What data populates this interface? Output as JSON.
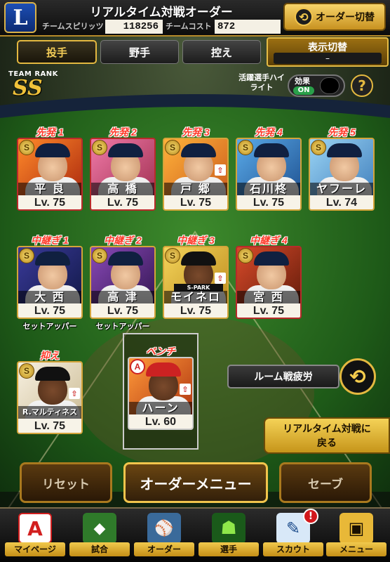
{
  "header": {
    "title": "リアルタイム対戦オーダー",
    "logo": "L",
    "spirit_label": "チームスピリッツ",
    "spirit_value": "118256",
    "cost_label": "チームコスト",
    "cost_value": "872",
    "order_switch": "オーダー切替"
  },
  "tabs": [
    "投手",
    "野手",
    "控え"
  ],
  "active_tab": 0,
  "display_switch": {
    "label": "表示切替",
    "value": "–"
  },
  "team_rank": {
    "label": "TEAM RANK",
    "value": "SS"
  },
  "highlight": {
    "label": "活躍選手ハイライト",
    "effect_label": "効果",
    "state": "ON"
  },
  "help": "?",
  "starters": [
    {
      "slot": "先発 1",
      "name": "平 良",
      "level": "Lv. 75"
    },
    {
      "slot": "先発 2",
      "name": "高 橋",
      "level": "Lv. 75"
    },
    {
      "slot": "先発 3",
      "name": "戸 郷",
      "level": "Lv. 75"
    },
    {
      "slot": "先発 4",
      "name": "石川柊",
      "level": "Lv. 75"
    },
    {
      "slot": "先発 5",
      "name": "ヤフーレ",
      "level": "Lv. 74"
    }
  ],
  "relievers": [
    {
      "slot": "中継ぎ 1",
      "name": "大 西",
      "level": "Lv. 75",
      "role": "セットアッパー"
    },
    {
      "slot": "中継ぎ 2",
      "name": "高 津",
      "level": "Lv. 75",
      "role": "セットアッパー"
    },
    {
      "slot": "中継ぎ 3",
      "name": "モイネロ",
      "level": "Lv. 75",
      "role": "",
      "tag": "S-PARK"
    },
    {
      "slot": "中継ぎ 4",
      "name": "宮 西",
      "level": "Lv. 75",
      "role": ""
    }
  ],
  "closer": {
    "slot": "抑え",
    "name": "R.マルティネス",
    "level": "Lv. 75"
  },
  "bench": {
    "slot": "ベンチ",
    "name": "ハーン",
    "level": "Lv. 60",
    "badge": "A"
  },
  "badge_letter": "S",
  "fatigue_label": "ルーム戦疲労",
  "back_button": [
    "リアルタイム対戦に",
    "戻る"
  ],
  "buttons": {
    "reset": "リセット",
    "order_menu": "オーダーメニュー",
    "save": "セーブ"
  },
  "nav": [
    "マイページ",
    "試合",
    "オーダー",
    "選手",
    "スカウト",
    "メニュー"
  ],
  "notification": "!"
}
